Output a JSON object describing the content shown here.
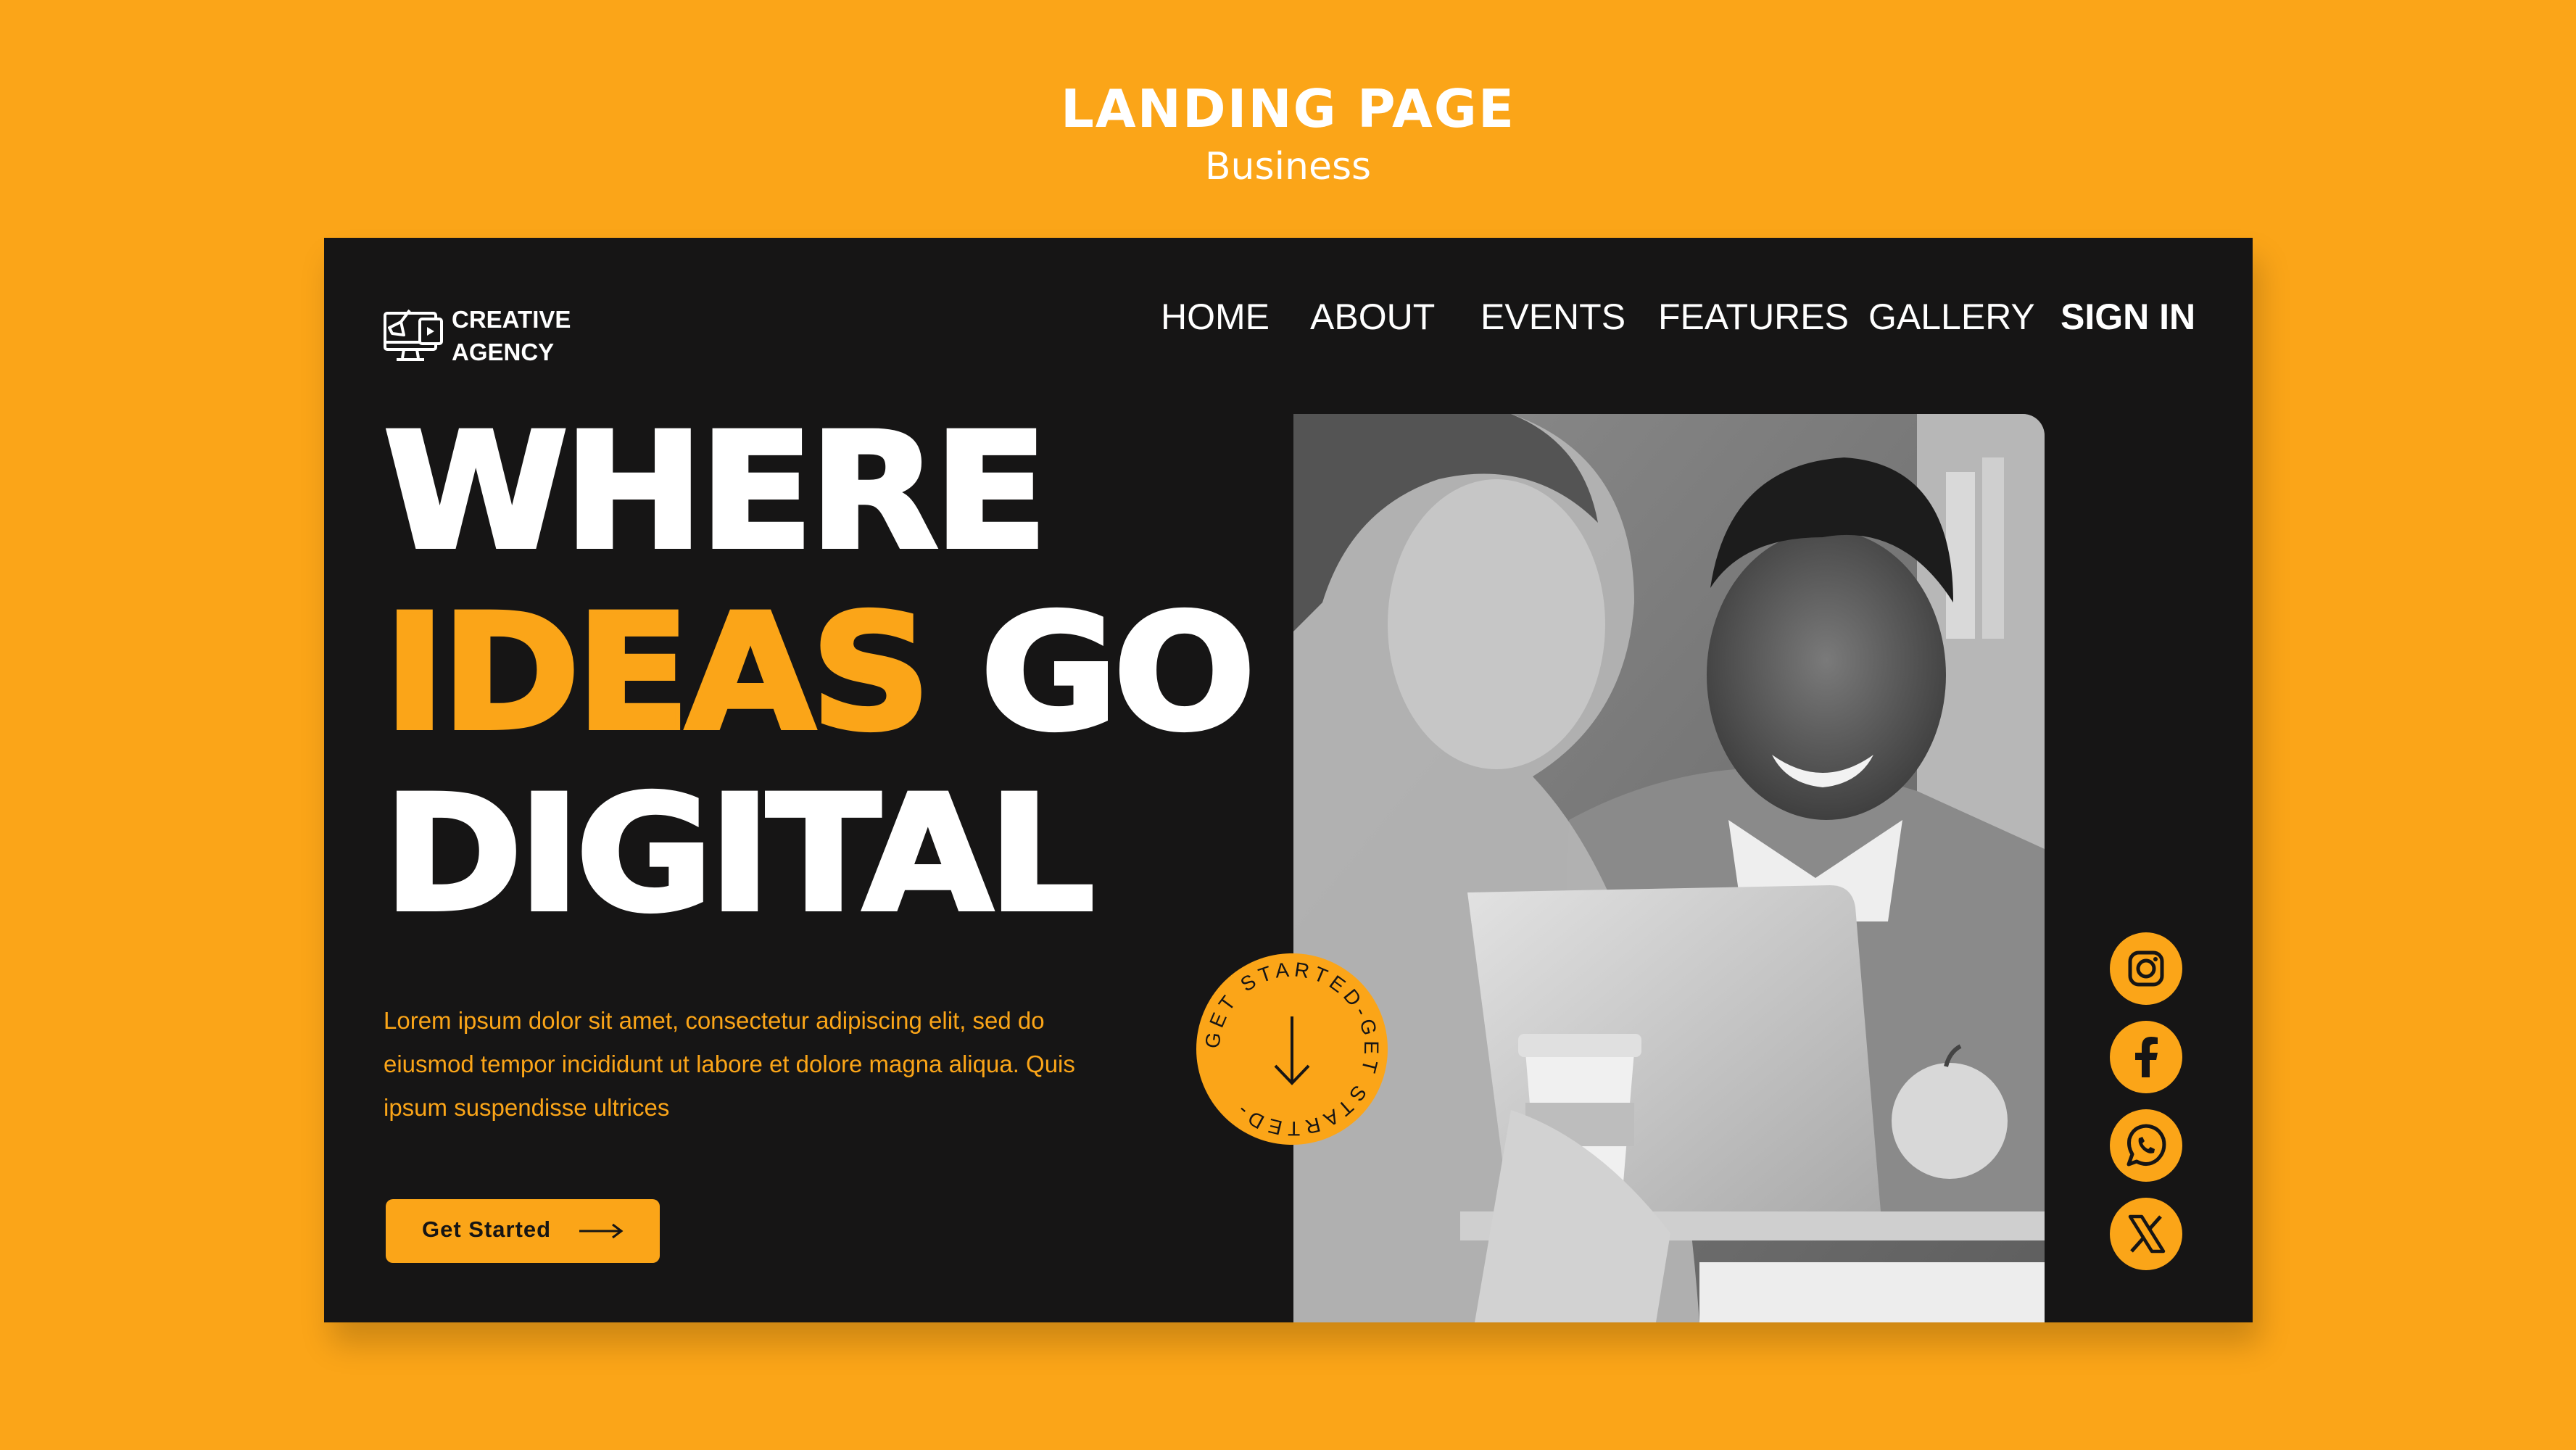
{
  "header": {
    "title": "LANDING PAGE",
    "subtitle": "Business"
  },
  "logo": {
    "line1": "CREATIVE",
    "line2": "AGENCY",
    "icon": "computer-megaphone-icon"
  },
  "nav": {
    "items": [
      "HOME",
      "ABOUT",
      "EVENTS",
      "FEATURES",
      "GALLERY"
    ],
    "signin": "SIGN IN"
  },
  "hero": {
    "line1": "WHERE",
    "line2_accent": "IDEAS",
    "line2_rest": " GO",
    "line3": "DIGITAL",
    "body": "Lorem ipsum dolor sit amet, consectetur adipiscing elit, sed do eiusmod tempor incididunt ut labore et dolore magna aliqua. Quis ipsum suspendisse ultrices",
    "cta_label": "Get Started",
    "badge_text": "GET STARTED-GET STARTED-"
  },
  "social": [
    {
      "name": "instagram",
      "icon": "instagram-icon"
    },
    {
      "name": "facebook",
      "icon": "facebook-icon"
    },
    {
      "name": "whatsapp",
      "icon": "whatsapp-icon"
    },
    {
      "name": "x",
      "icon": "x-icon"
    }
  ],
  "colors": {
    "accent": "#FBA518",
    "card_bg": "#161515",
    "text": "#FFFFFF"
  }
}
